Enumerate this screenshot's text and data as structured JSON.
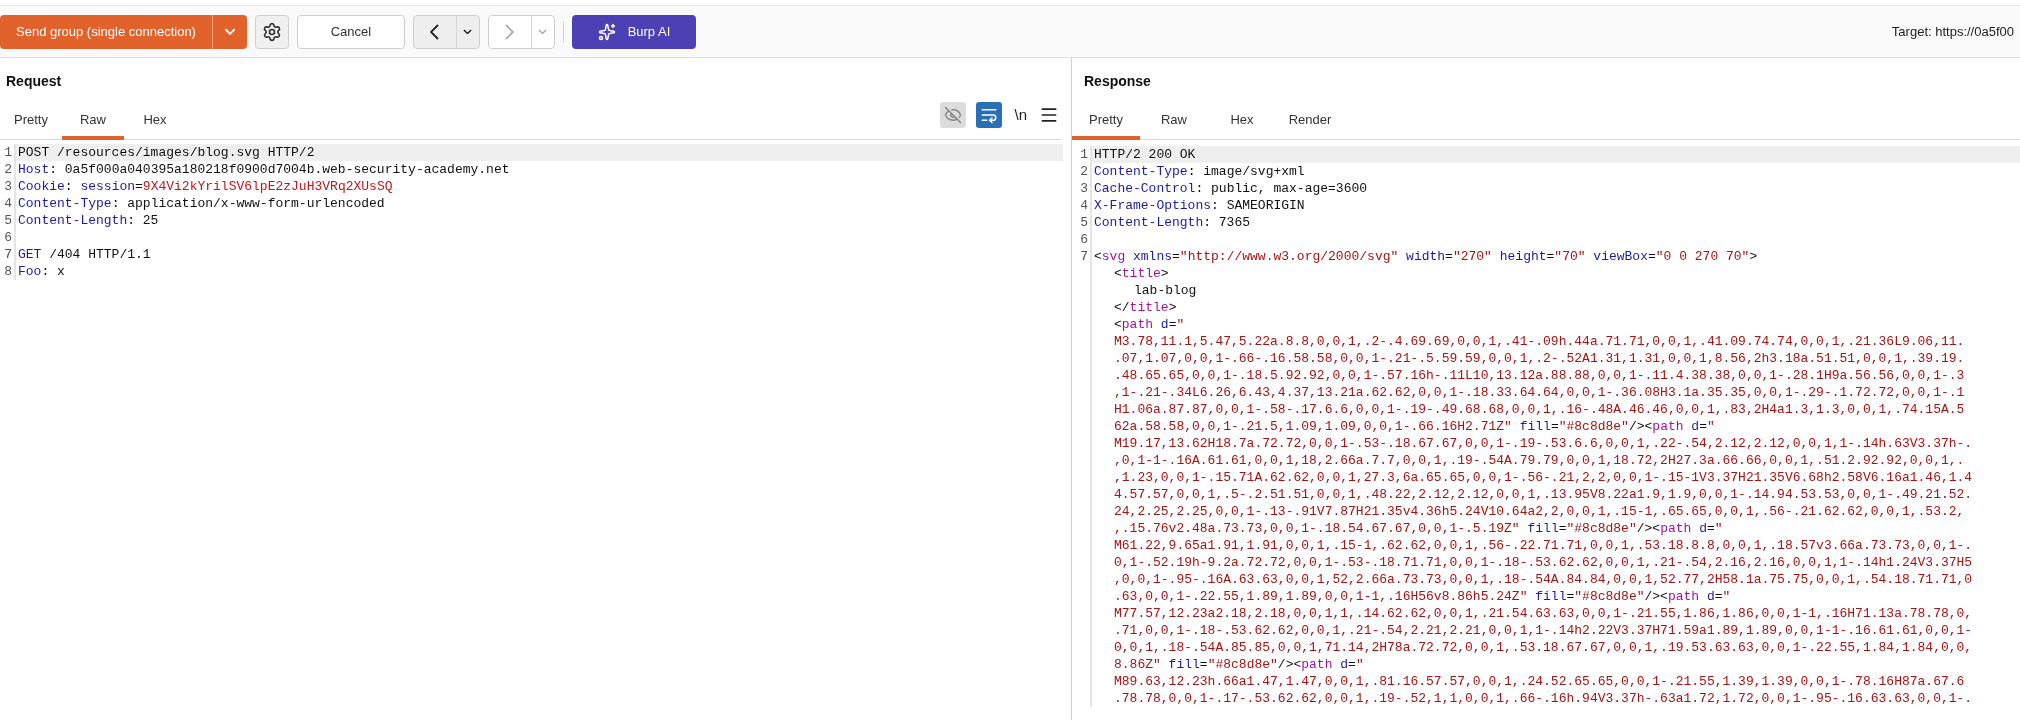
{
  "toolbar": {
    "send_button": "Send group (single connection)",
    "cancel_button": "Cancel",
    "nav": [
      {
        "kind": "back",
        "disabled": false
      },
      {
        "kind": "forward",
        "disabled": true
      }
    ],
    "ai_button": "Burp AI",
    "target": "Target: https://0a5f00"
  },
  "request": {
    "title": "Request",
    "tabs": [
      {
        "label": "Pretty",
        "selected": false
      },
      {
        "label": "Raw",
        "selected": true
      },
      {
        "label": "Hex",
        "selected": false
      }
    ],
    "tools": {
      "hide_icon_active": false,
      "wrap_active": true,
      "newline_label": "\\n"
    },
    "lines": [
      {
        "number": "1",
        "highlighted": true,
        "tokens": [
          {
            "kind": "plain",
            "text": "POST /resources/images/blog.svg HTTP/2"
          }
        ]
      },
      {
        "number": "2",
        "highlighted": false,
        "tokens": [
          {
            "kind": "name",
            "text": "Host"
          },
          {
            "kind": "plain",
            "text": ": 0a5f000a040395a180218f0900d7004b.web-security-academy.net"
          }
        ]
      },
      {
        "number": "3",
        "highlighted": false,
        "tokens": [
          {
            "kind": "name",
            "text": "Cookie"
          },
          {
            "kind": "plain",
            "text": ": "
          },
          {
            "kind": "name",
            "text": "session"
          },
          {
            "kind": "plain",
            "text": "="
          },
          {
            "kind": "secret",
            "text": "9X4Vi2kYrilSV6lpE2zJuH3VRq2XUsSQ"
          }
        ]
      },
      {
        "number": "4",
        "highlighted": false,
        "tokens": [
          {
            "kind": "name",
            "text": "Content-Type"
          },
          {
            "kind": "plain",
            "text": ": application/x-www-form-urlencoded"
          }
        ]
      },
      {
        "number": "5",
        "highlighted": false,
        "tokens": [
          {
            "kind": "name",
            "text": "Content-Length"
          },
          {
            "kind": "plain",
            "text": ": 25"
          }
        ]
      },
      {
        "number": "6",
        "highlighted": false
      },
      {
        "number": "7",
        "highlighted": false,
        "tokens": [
          {
            "kind": "name",
            "text": "GET"
          },
          {
            "kind": "plain",
            "text": " /404 HTTP/1.1"
          }
        ]
      },
      {
        "number": "8",
        "highlighted": false,
        "tokens": [
          {
            "kind": "name",
            "text": "Foo"
          },
          {
            "kind": "plain",
            "text": ": x"
          }
        ]
      }
    ]
  },
  "response": {
    "title": "Response",
    "tabs": [
      {
        "label": "Pretty",
        "selected": true
      },
      {
        "label": "Raw",
        "selected": false
      },
      {
        "label": "Hex",
        "selected": false
      },
      {
        "label": "Render",
        "selected": false
      }
    ],
    "lines": [
      {
        "number": "1",
        "highlighted": true,
        "tokens": [
          {
            "kind": "plain",
            "text": "HTTP/2 200 OK"
          }
        ]
      },
      {
        "number": "2",
        "highlighted": false,
        "tokens": [
          {
            "kind": "name",
            "text": "Content-Type"
          },
          {
            "kind": "plain",
            "text": ": image/svg+xml"
          }
        ]
      },
      {
        "number": "3",
        "highlighted": false,
        "tokens": [
          {
            "kind": "name",
            "text": "Cache-Control"
          },
          {
            "kind": "plain",
            "text": ": public, max-age=3600"
          }
        ]
      },
      {
        "number": "4",
        "highlighted": false,
        "tokens": [
          {
            "kind": "name",
            "text": "X-Frame-Options"
          },
          {
            "kind": "plain",
            "text": ": SAMEORIGIN"
          }
        ]
      },
      {
        "number": "5",
        "highlighted": false,
        "tokens": [
          {
            "kind": "name",
            "text": "Content-Length"
          },
          {
            "kind": "plain",
            "text": ": 7365"
          }
        ]
      },
      {
        "number": "6",
        "highlighted": false
      },
      {
        "number": "7",
        "highlighted": false,
        "tokens": [
          {
            "kind": "plain",
            "text": "<"
          },
          {
            "kind": "tag",
            "text": "svg"
          },
          {
            "kind": "name",
            "text": " xmlns"
          },
          {
            "kind": "plain",
            "text": "="
          },
          {
            "kind": "string",
            "text": "\"http://www.w3.org/2000/svg\""
          },
          {
            "kind": "name",
            "text": " width"
          },
          {
            "kind": "plain",
            "text": "="
          },
          {
            "kind": "string",
            "text": "\"270\""
          },
          {
            "kind": "name",
            "text": " height"
          },
          {
            "kind": "plain",
            "text": "="
          },
          {
            "kind": "string",
            "text": "\"70\""
          },
          {
            "kind": "name",
            "text": " viewBox"
          },
          {
            "kind": "plain",
            "text": "="
          },
          {
            "kind": "string",
            "text": "\"0 0 270 70\""
          },
          {
            "kind": "plain",
            "text": ">"
          }
        ],
        "children": [
          {
            "highlighted": false,
            "tokens": [
              {
                "kind": "plain",
                "text": "<"
              },
              {
                "kind": "tag",
                "text": "title"
              },
              {
                "kind": "plain",
                "text": ">"
              }
            ],
            "children": [
              {
                "highlighted": false,
                "tokens": [
                  {
                    "kind": "plain",
                    "text": "lab-blog"
                  }
                ]
              }
            ]
          },
          {
            "highlighted": false,
            "tokens": [
              {
                "kind": "plain",
                "text": "</"
              },
              {
                "kind": "tag",
                "text": "title"
              },
              {
                "kind": "plain",
                "text": ">"
              }
            ]
          },
          {
            "highlighted": false,
            "tokens": [
              {
                "kind": "plain",
                "text": "<"
              },
              {
                "kind": "tag",
                "text": "path"
              },
              {
                "kind": "name",
                "text": " d"
              },
              {
                "kind": "plain",
                "text": "="
              },
              {
                "kind": "string",
                "text": "\""
              }
            ]
          },
          {
            "highlighted": false,
            "tokens": [
              {
                "kind": "string",
                "text": "M3.78,11.1,5.47,5.22a.8.8,0,0,1,.2-.4.69.69,0,0,1,.41-.09h.44a.71.71,0,0,1,.41.09.74.74,0,0,1,.21.36L9.06,11."
              }
            ]
          },
          {
            "highlighted": false,
            "tokens": [
              {
                "kind": "string",
                "text": ".07,1.07,0,0,1-.66-.16.58.58,0,0,1-.21-.5.59.59,0,0,1,.2-.52A1.31,1.31,0,0,1,8.56,2h3.18a.51.51,0,0,1,.39.19."
              }
            ]
          },
          {
            "highlighted": false,
            "tokens": [
              {
                "kind": "string",
                "text": ".48.65.65,0,0,1-.18.5.92.92,0,0,1-.57.16h-.11L10,13.12a.88.88,0,0,1-.11.4.38.38,0,0,1-.28.1H9a.56.56,0,0,1-.3"
              }
            ]
          },
          {
            "highlighted": false,
            "tokens": [
              {
                "kind": "string",
                "text": ",1-.21-.34L6.26,6.43,4.37,13.21a.62.62,0,0,1-.18.33.64.64,0,0,1-.36.08H3.1a.35.35,0,0,1-.29-.1.72.72,0,0,1-.1"
              }
            ]
          },
          {
            "highlighted": false,
            "tokens": [
              {
                "kind": "string",
                "text": "H1.06a.87.87,0,0,1-.58-.17.6.6,0,0,1-.19-.49.68.68,0,0,1,.16-.48A.46.46,0,0,1,.83,2H4a1.3,1.3,0,0,1,.74.15A.5"
              }
            ]
          },
          {
            "highlighted": false,
            "tokens": [
              {
                "kind": "string",
                "text": "62a.58.58,0,0,1-.21.5,1.09,1.09,0,0,1-.66.16H2.71Z\""
              },
              {
                "kind": "name",
                "text": " fill"
              },
              {
                "kind": "plain",
                "text": "="
              },
              {
                "kind": "string",
                "text": "\"#8c8d8e\""
              },
              {
                "kind": "plain",
                "text": "/><"
              },
              {
                "kind": "tag",
                "text": "path"
              },
              {
                "kind": "name",
                "text": " d"
              },
              {
                "kind": "plain",
                "text": "="
              },
              {
                "kind": "string",
                "text": "\""
              }
            ]
          },
          {
            "highlighted": false,
            "tokens": [
              {
                "kind": "string",
                "text": "M19.17,13.62H18.7a.72.72,0,0,1-.53-.18.67.67,0,0,1-.19-.53.6.6,0,0,1,.22-.54,2.12,2.12,0,0,1,1-.14h.63V3.37h-."
              }
            ]
          },
          {
            "highlighted": false,
            "tokens": [
              {
                "kind": "string",
                "text": ",0,1-1-.16A.61.61,0,0,1,18,2.66a.7.7,0,0,1,.19-.54A.79.79,0,0,1,18.72,2H27.3a.66.66,0,0,1,.51.2.92.92,0,0,1,."
              }
            ]
          },
          {
            "highlighted": false,
            "tokens": [
              {
                "kind": "string",
                "text": ",1.23,0,0,1-.15.71A.62.62,0,0,1,27.3,6a.65.65,0,0,1-.56-.21,2,2,0,0,1-.15-1V3.37H21.35V6.68h2.58V6.16a1.46,1.4"
              }
            ]
          },
          {
            "highlighted": false,
            "tokens": [
              {
                "kind": "string",
                "text": "4.57.57,0,0,1,.5-.2.51.51,0,0,1,.48.22,2.12,2.12,0,0,1,.13.95V8.22a1.9,1.9,0,0,1-.14.94.53.53,0,0,1-.49.21.52."
              }
            ]
          },
          {
            "highlighted": false,
            "tokens": [
              {
                "kind": "string",
                "text": "24,2.25,2.25,0,0,1-.13-.91V7.87H21.35v4.36h5.24V10.64a2,2,0,0,1,.15-1,.65.65,0,0,1,.56-.21.62.62,0,0,1,.53.2,"
              }
            ]
          },
          {
            "highlighted": false,
            "tokens": [
              {
                "kind": "string",
                "text": ",.15.76v2.48a.73.73,0,0,1-.18.54.67.67,0,0,1-.5.19Z\""
              },
              {
                "kind": "name",
                "text": " fill"
              },
              {
                "kind": "plain",
                "text": "="
              },
              {
                "kind": "string",
                "text": "\"#8c8d8e\""
              },
              {
                "kind": "plain",
                "text": "/><"
              },
              {
                "kind": "tag",
                "text": "path"
              },
              {
                "kind": "name",
                "text": " d"
              },
              {
                "kind": "plain",
                "text": "="
              },
              {
                "kind": "string",
                "text": "\""
              }
            ]
          },
          {
            "highlighted": false,
            "tokens": [
              {
                "kind": "string",
                "text": "M61.22,9.65a1.91,1.91,0,0,1,.15-1,.62.62,0,0,1,.56-.22.71.71,0,0,1,.53.18.8.8,0,0,1,.18.57v3.66a.73.73,0,0,1-."
              }
            ]
          },
          {
            "highlighted": false,
            "tokens": [
              {
                "kind": "string",
                "text": "0,1-.52.19h-9.2a.72.72,0,0,1-.53-.18.71.71,0,0,1-.18-.53.62.62,0,0,1,.21-.54,2.16,2.16,0,0,1,1-.14h1.24V3.37H5"
              }
            ]
          },
          {
            "highlighted": false,
            "tokens": [
              {
                "kind": "string",
                "text": ",0,0,1-.95-.16A.63.63,0,0,1,52,2.66a.73.73,0,0,1,.18-.54A.84.84,0,0,1,52.77,2H58.1a.75.75,0,0,1,.54.18.71.71,0"
              }
            ]
          },
          {
            "highlighted": false,
            "tokens": [
              {
                "kind": "string",
                "text": ".63,0,0,1-.22.55,1.89,1.89,0,0,1-1,.16H56v8.86h5.24Z\""
              },
              {
                "kind": "name",
                "text": " fill"
              },
              {
                "kind": "plain",
                "text": "="
              },
              {
                "kind": "string",
                "text": "\"#8c8d8e\""
              },
              {
                "kind": "plain",
                "text": "/><"
              },
              {
                "kind": "tag",
                "text": "path"
              },
              {
                "kind": "name",
                "text": " d"
              },
              {
                "kind": "plain",
                "text": "="
              },
              {
                "kind": "string",
                "text": "\""
              }
            ]
          },
          {
            "highlighted": false,
            "tokens": [
              {
                "kind": "string",
                "text": "M77.57,12.23a2.18,2.18,0,0,1,1,.14.62.62,0,0,1,.21.54.63.63,0,0,1-.21.55,1.86,1.86,0,0,1-1,.16H71.13a.78.78,0,"
              }
            ]
          },
          {
            "highlighted": false,
            "tokens": [
              {
                "kind": "string",
                "text": ".71,0,0,1-.18-.53.62.62,0,0,1,.21-.54,2.21,2.21,0,0,1,1-.14h2.22V3.37H71.59a1.89,1.89,0,0,1-1-.16.61.61,0,0,1-"
              }
            ]
          },
          {
            "highlighted": false,
            "tokens": [
              {
                "kind": "string",
                "text": "0,0,1,.18-.54A.85.85,0,0,1,71.14,2H78a.72.72,0,0,1,.53.18.67.67,0,0,1,.19.53.63.63,0,0,1-.22.55,1.84,1.84,0,0,"
              }
            ]
          },
          {
            "highlighted": false,
            "tokens": [
              {
                "kind": "string",
                "text": "8.86Z\""
              },
              {
                "kind": "name",
                "text": " fill"
              },
              {
                "kind": "plain",
                "text": "="
              },
              {
                "kind": "string",
                "text": "\"#8c8d8e\""
              },
              {
                "kind": "plain",
                "text": "/><"
              },
              {
                "kind": "tag",
                "text": "path"
              },
              {
                "kind": "name",
                "text": " d"
              },
              {
                "kind": "plain",
                "text": "="
              },
              {
                "kind": "string",
                "text": "\""
              }
            ]
          },
          {
            "highlighted": false,
            "tokens": [
              {
                "kind": "string",
                "text": "M89.63,12.23h.66a1.47,1.47,0,0,1,.81.16.57.57,0,0,1,.24.52.65.65,0,0,1-.21.55,1.39,1.39,0,0,1-.78.16H87a.67.6"
              }
            ]
          },
          {
            "highlighted": false,
            "tokens": [
              {
                "kind": "string",
                "text": ".78.78,0,0,1-.17-.53.62.62,0,0,1,.19-.52,1,1,0,0,1,.66-.16h.94V3.37h-.63a1.72,1.72,0,0,1-.95-.16.63.63,0,0,1-."
              }
            ]
          }
        ]
      }
    ]
  }
}
